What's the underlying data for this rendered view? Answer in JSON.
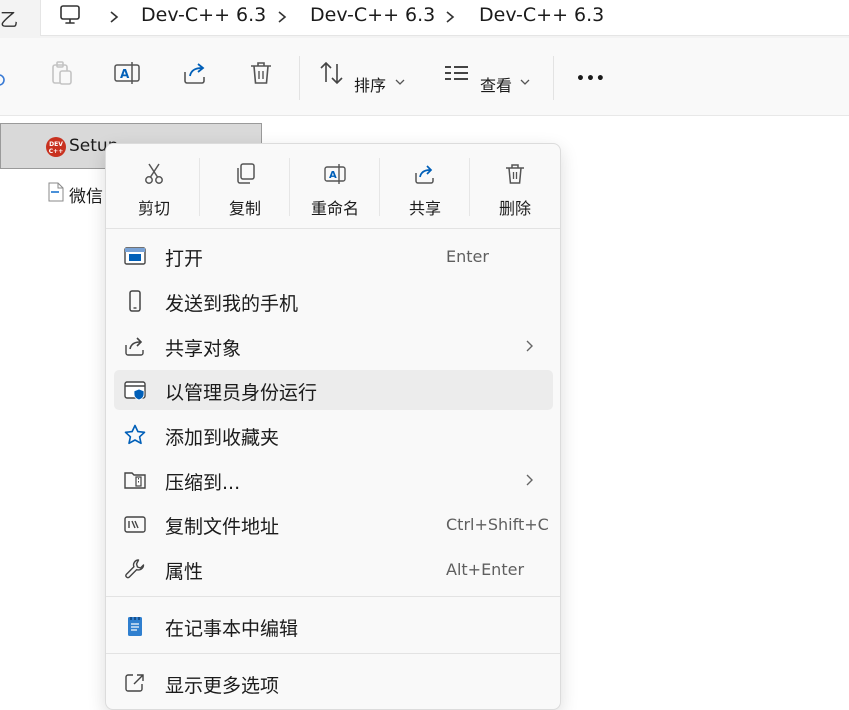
{
  "address_bar": {
    "cut_text": "乙",
    "crumbs": [
      "Dev-C++ 6.3",
      "Dev-C++ 6.3",
      "Dev-C++ 6.3"
    ]
  },
  "command_bar": {
    "sort_label": "排序",
    "view_label": "查看",
    "more_label": "•••"
  },
  "files": [
    {
      "name": "Setup",
      "icon": "dev-cpp-icon",
      "selected": true
    },
    {
      "name": "微信",
      "icon": "document-icon",
      "selected": false
    }
  ],
  "context_menu": {
    "quick_actions": [
      {
        "label": "剪切",
        "icon": "cut-icon"
      },
      {
        "label": "复制",
        "icon": "copy-icon"
      },
      {
        "label": "重命名",
        "icon": "rename-icon"
      },
      {
        "label": "共享",
        "icon": "share-icon"
      },
      {
        "label": "删除",
        "icon": "delete-icon"
      }
    ],
    "items": [
      {
        "label": "打开",
        "shortcut": "Enter",
        "icon": "open-window-icon"
      },
      {
        "label": "发送到我的手机",
        "icon": "phone-icon"
      },
      {
        "label": "共享对象",
        "icon": "share-icon",
        "submenu": true
      },
      {
        "label": "以管理员身份运行",
        "icon": "shield-icon",
        "hovered": true
      },
      {
        "label": "添加到收藏夹",
        "icon": "star-icon"
      },
      {
        "label": "压缩到...",
        "icon": "zip-folder-icon",
        "submenu": true
      },
      {
        "label": "复制文件地址",
        "shortcut": "Ctrl+Shift+C",
        "icon": "copy-path-icon"
      },
      {
        "label": "属性",
        "shortcut": "Alt+Enter",
        "icon": "wrench-icon"
      },
      {
        "label": "在记事本中编辑",
        "icon": "notepad-icon"
      },
      {
        "label": "显示更多选项",
        "icon": "show-more-icon"
      }
    ]
  },
  "colors": {
    "accent_blue": "#005fb8",
    "icon_gray": "#5a5a5a",
    "hover_bg": "#ececec",
    "selection_bg": "#d9d9d9"
  }
}
